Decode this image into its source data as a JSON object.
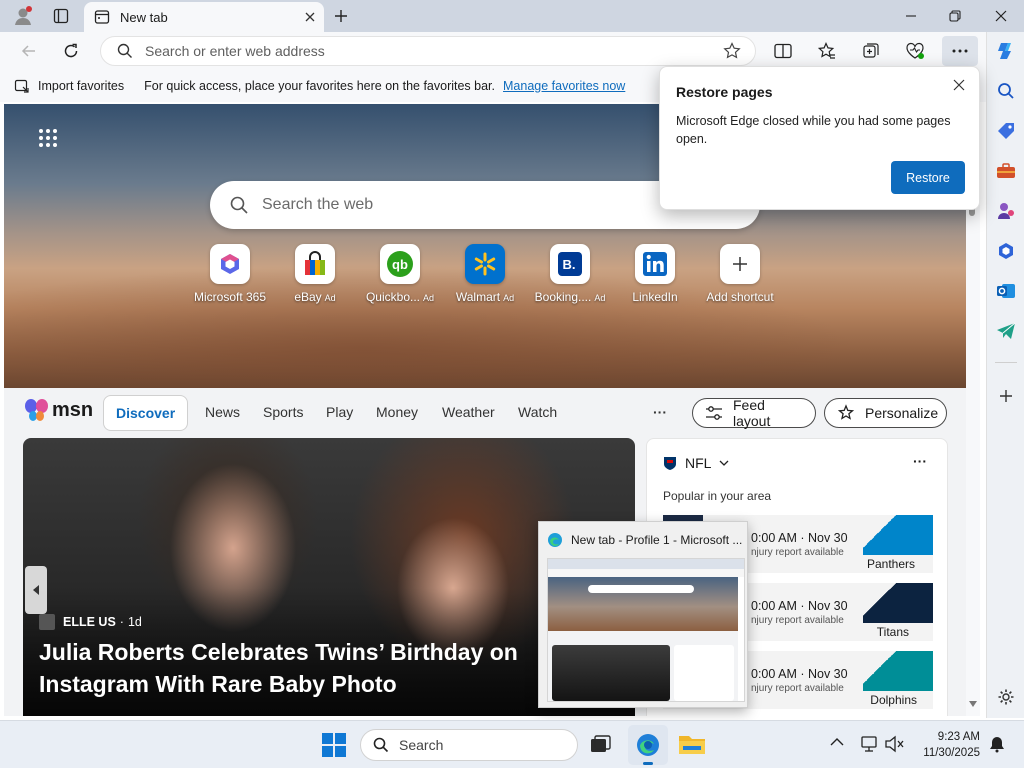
{
  "browser": {
    "tab_title": "New tab",
    "address_placeholder": "Search or enter web address"
  },
  "favorites_bar": {
    "import_label": "Import favorites",
    "message": "For quick access, place your favorites here on the favorites bar.",
    "manage_link": "Manage favorites now"
  },
  "restore_popup": {
    "title": "Restore pages",
    "message": "Microsoft Edge closed while you had some pages open.",
    "button": "Restore"
  },
  "newtab": {
    "search_placeholder": "Search the web",
    "shortcuts": [
      {
        "label": "Microsoft 365",
        "ad": ""
      },
      {
        "label": "eBay",
        "ad": "Ad"
      },
      {
        "label": "Quickbo...",
        "ad": "Ad"
      },
      {
        "label": "Walmart",
        "ad": "Ad"
      },
      {
        "label": "Booking....",
        "ad": "Ad"
      },
      {
        "label": "LinkedIn",
        "ad": ""
      },
      {
        "label": "Add shortcut",
        "ad": ""
      }
    ]
  },
  "msn": {
    "brand": "msn",
    "nav": [
      "Discover",
      "News",
      "Sports",
      "Play",
      "Money",
      "Weather",
      "Watch"
    ],
    "more": "···",
    "feed_layout": "Feed layout",
    "personalize": "Personalize"
  },
  "article": {
    "source": "ELLE US",
    "age": "1d",
    "headline": "Julia Roberts Celebrates Twins’ Birthday on Instagram With Rare Baby Photo"
  },
  "nfl_card": {
    "league": "NFL",
    "subtitle": "Popular in your area",
    "games": [
      {
        "time": "0:00 AM · Nov 30",
        "status": "njury report available",
        "team": "Panthers"
      },
      {
        "time": "0:00 AM · Nov 30",
        "status": "njury report available",
        "team": "Titans"
      },
      {
        "time": "0:00 AM · Nov 30",
        "status": "njury report available",
        "team": "Dolphins"
      }
    ]
  },
  "preview": {
    "title": "New tab - Profile 1 - Microsoft ..."
  },
  "taskbar": {
    "search": "Search",
    "time": "9:23 AM",
    "date": "11/30/2025"
  },
  "colors": {
    "accent": "#0f6cbd",
    "restore_button": "#0f6cbd"
  }
}
